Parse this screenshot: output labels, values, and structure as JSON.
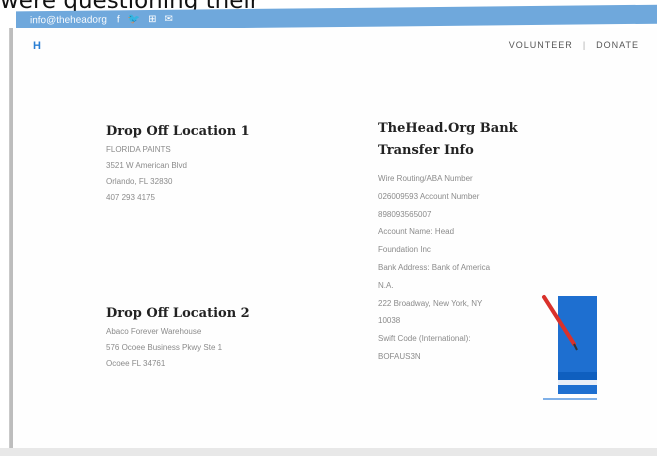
{
  "caption": "were questioning their",
  "topbar": {
    "email": "info@theheadorg",
    "social": [
      "f",
      "🐦",
      "⊞",
      "✉"
    ]
  },
  "header": {
    "logo": "H",
    "nav": [
      "VOLUNTEER",
      "DONATE"
    ]
  },
  "location1": {
    "title": "Drop Off Location 1",
    "lines": [
      "FLORIDA PAINTS",
      "3521 W American Blvd",
      "Orlando, FL 32830",
      "407 293 4175"
    ]
  },
  "location2": {
    "title": "Drop Off Location 2",
    "lines": [
      "Abaco Forever Warehouse",
      "576 Ocoee Business Pkwy Ste 1",
      "Ocoee FL 34761"
    ]
  },
  "bank": {
    "title_line1": "TheHead.Org Bank",
    "title_line2": "Transfer Info",
    "lines": [
      "Wire Routing/ABA Number",
      "026009593 Account Number",
      "898093565007",
      "Account Name: Head",
      "Foundation Inc",
      "Bank Address: Bank of America",
      "N.A.",
      "222 Broadway, New York, NY",
      "10038",
      "Swift Code (International):",
      "BOFAUS3N"
    ]
  },
  "colors": {
    "topbar": "#6fa8dc",
    "book_blue": "#1e6fd0",
    "pen_red": "#d9312b"
  },
  "icons": {
    "illustration": "book-with-pen-icon"
  }
}
